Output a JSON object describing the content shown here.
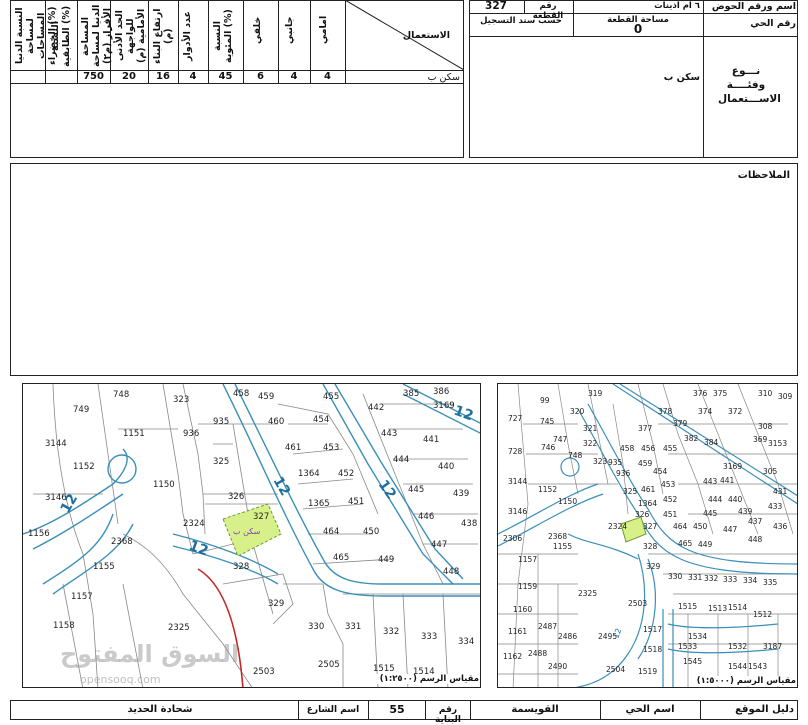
{
  "table": {
    "headers": [
      "النسبة الدنيا لمساحة المساحات الخضراء (%)",
      "النسبة الطابقية (%)",
      "المساحة الدنيا لمساحة الأفراز (م٢)",
      "الحد الأدنى للواجهة الأمامية (م)",
      "ارتفاع البناء (م)",
      "عدد الأدوار",
      "النسبة المئوية (%)",
      "خلفي",
      "جانبي",
      "امامي"
    ],
    "row_values": [
      "",
      "",
      "750",
      "20",
      "16",
      "4",
      "45",
      "6",
      "4",
      "4"
    ],
    "usage_header": "الاستعمال",
    "usage_value": "سكن ب"
  },
  "parcel_info": {
    "basin_label": "اسم ورقم الحوض",
    "basin_value": "٦ ام اذينات",
    "parcel_label": "رقم القطعة",
    "parcel_value": "327",
    "district_label": "رقم الحي",
    "area_label": "مساحة القطعة",
    "area_value": "0",
    "area_note": "حسب سند التسجيل",
    "usage_type_label": "نـــوع وفئــــة الاســـتعمال",
    "usage_type_value": "سكن ب"
  },
  "notes": {
    "label": "الملاحظات"
  },
  "maps": {
    "left_scale": "مقياس الرسم (١:٢٥٠٠)",
    "right_scale": "مقياس الرسم (١:٥٠٠٠)",
    "highlight_text": "سكن ب",
    "watermark_ar": "السوق المفتوح",
    "watermark_en": "opensooq.com"
  },
  "footer": {
    "guide_label": "دليل الموقع",
    "district_label": "اسم الحي",
    "district_value": "القويسمة",
    "building_label": "رقم البناية",
    "building_value": "55",
    "street_label": "اسم الشارع",
    "street_value": "شحادة الحديد"
  }
}
